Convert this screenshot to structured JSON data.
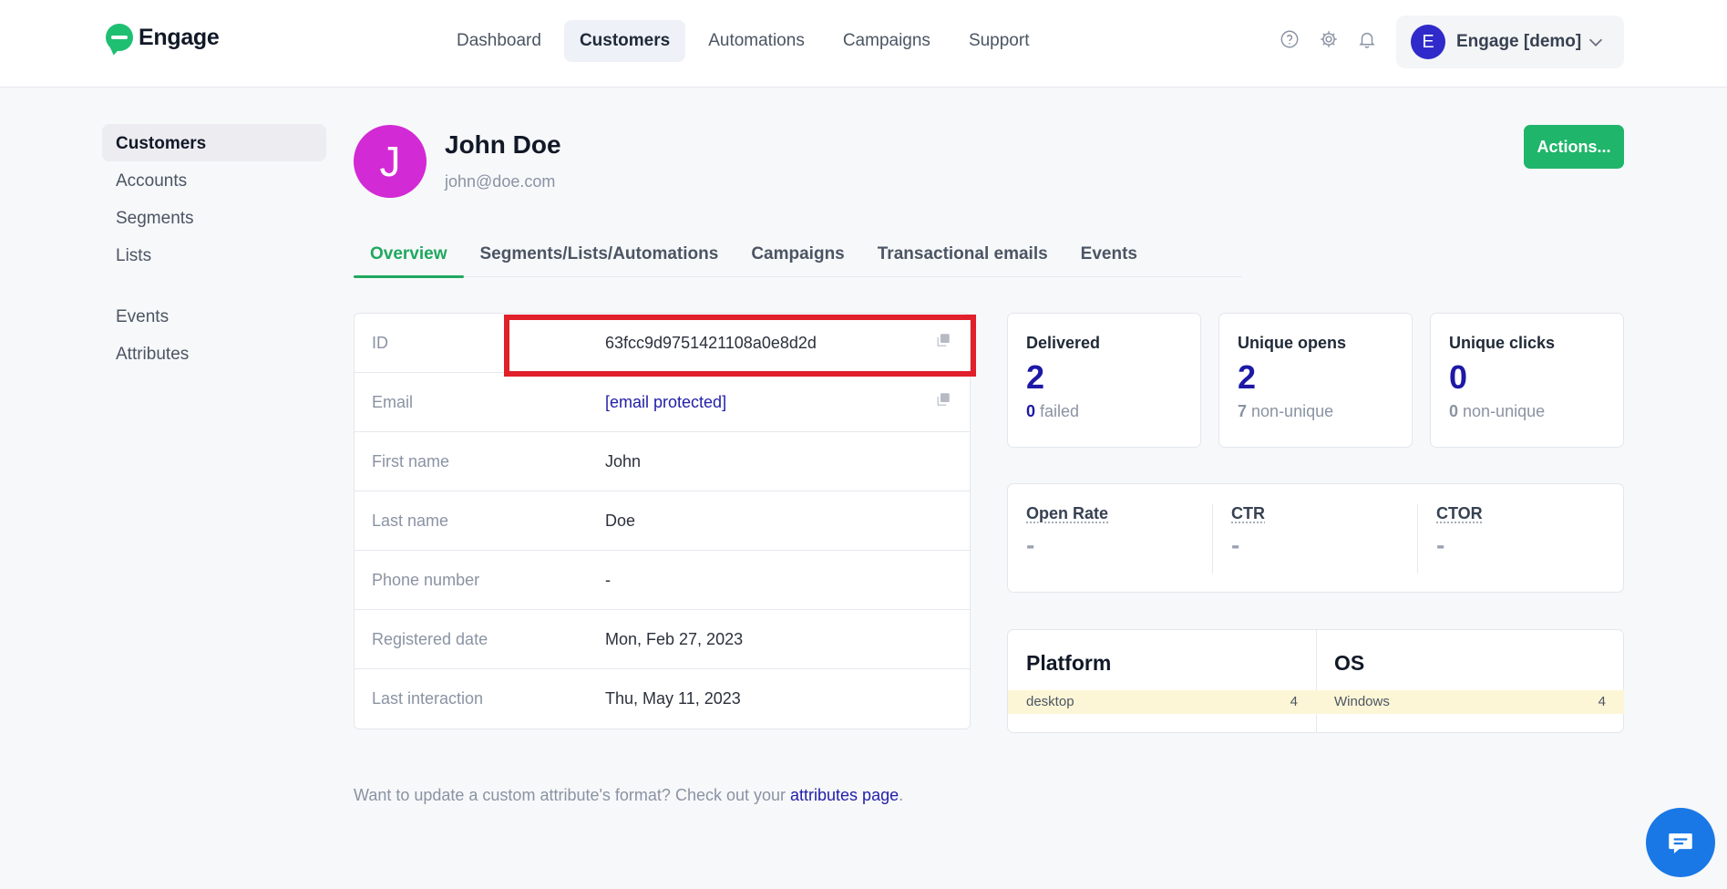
{
  "brand": {
    "name": "Engage"
  },
  "nav": {
    "items": [
      {
        "label": "Dashboard"
      },
      {
        "label": "Customers"
      },
      {
        "label": "Automations"
      },
      {
        "label": "Campaigns"
      },
      {
        "label": "Support"
      }
    ],
    "active": "Customers"
  },
  "header": {
    "icons": [
      "help-circle-icon",
      "gear-icon",
      "bell-icon"
    ],
    "account": {
      "initial": "E",
      "name": "Engage [demo]"
    }
  },
  "sidebar": {
    "items": [
      {
        "label": "Customers"
      },
      {
        "label": "Accounts"
      },
      {
        "label": "Segments"
      },
      {
        "label": "Lists"
      },
      {
        "label": "Events"
      },
      {
        "label": "Attributes"
      }
    ]
  },
  "profile": {
    "initial": "J",
    "name": "John Doe",
    "email": "john@doe.com",
    "actions_label": "Actions..."
  },
  "tabs": [
    {
      "label": "Overview"
    },
    {
      "label": "Segments/Lists/Automations"
    },
    {
      "label": "Campaigns"
    },
    {
      "label": "Transactional emails"
    },
    {
      "label": "Events"
    }
  ],
  "details": [
    {
      "label": "ID",
      "value": "63fcc9d9751421108a0e8d2d"
    },
    {
      "label": "Email",
      "value": "[email protected]"
    },
    {
      "label": "First name",
      "value": "John"
    },
    {
      "label": "Last name",
      "value": "Doe"
    },
    {
      "label": "Phone number",
      "value": "-"
    },
    {
      "label": "Registered date",
      "value": "Mon, Feb 27, 2023"
    },
    {
      "label": "Last interaction",
      "value": "Thu, May 11, 2023"
    }
  ],
  "stats": {
    "delivered": {
      "title": "Delivered",
      "value": "2",
      "sub_value": "0",
      "sub_label": "failed"
    },
    "opens": {
      "title": "Unique opens",
      "value": "2",
      "sub_value": "7",
      "sub_label": "non-unique"
    },
    "clicks": {
      "title": "Unique clicks",
      "value": "0",
      "sub_value": "0",
      "sub_label": "non-unique"
    }
  },
  "rates": [
    {
      "title": "Open Rate",
      "value": "-"
    },
    {
      "title": "CTR",
      "value": "-"
    },
    {
      "title": "CTOR",
      "value": "-"
    }
  ],
  "platform": {
    "title": "Platform",
    "rows": [
      {
        "name": "desktop",
        "count": "4"
      }
    ]
  },
  "os": {
    "title": "OS",
    "rows": [
      {
        "name": "Windows",
        "count": "4"
      }
    ]
  },
  "footer": {
    "text": "Want to update a custom attribute's format? Check out your ",
    "link": "attributes page",
    "end": "."
  },
  "colors": {
    "accent_green": "#1fb56a",
    "primary_blue": "#1d19a6",
    "avatar_magenta": "#d22ad4",
    "highlight_red": "#e0202a",
    "chat_blue": "#1a78e6"
  }
}
